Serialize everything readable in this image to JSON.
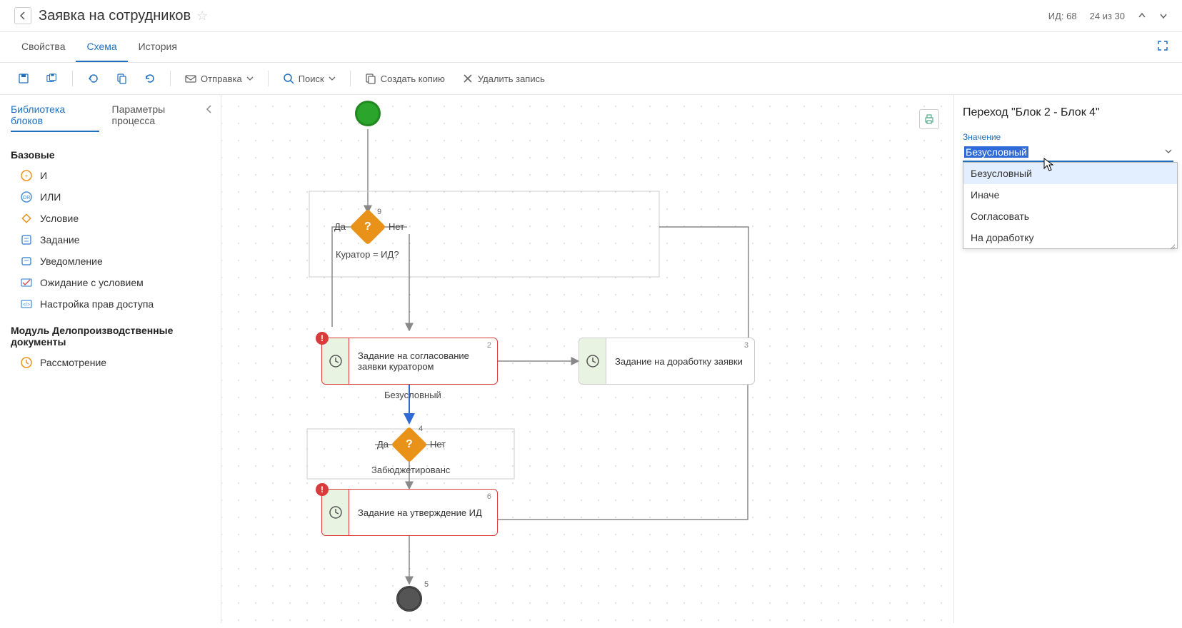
{
  "header": {
    "title": "Заявка на сотрудников",
    "id_label": "ИД:",
    "id_value": "68",
    "pager": "24 из 30"
  },
  "tabs": {
    "props": "Свойства",
    "scheme": "Схема",
    "history": "История"
  },
  "toolbar": {
    "send": "Отправка",
    "search": "Поиск",
    "copy": "Создать копию",
    "delete": "Удалить запись"
  },
  "sidebar": {
    "tab1": "Библиотека блоков",
    "tab2": "Параметры процесса",
    "group1": "Базовые",
    "items": {
      "and": "И",
      "or": "ИЛИ",
      "cond": "Условие",
      "task": "Задание",
      "notify": "Уведомление",
      "wait": "Ожидание с условием",
      "access": "Настройка прав доступа"
    },
    "group2": "Модуль Делопроизводственные документы",
    "items2": {
      "review": "Рассмотрение"
    }
  },
  "canvas": {
    "yes": "Да",
    "no": "Нет",
    "cond1": "Куратор = ИД?",
    "cond1_num": "9",
    "task2": "Задание на согласование заявки куратором",
    "task2_num": "2",
    "task3": "Задание на доработку заявки",
    "task3_num": "3",
    "trans_label": "Безусловный",
    "cond2": "Забюджетированс",
    "cond2_num": "4",
    "task6": "Задание на утверждение ИД",
    "task6_num": "6",
    "end_num": "5"
  },
  "rpanel": {
    "title": "Переход \"Блок 2 - Блок 4\"",
    "field_label": "Значение",
    "value": "Безусловный",
    "options": {
      "o1": "Безусловный",
      "o2": "Иначе",
      "o3": "Согласовать",
      "o4": "На доработку"
    }
  }
}
